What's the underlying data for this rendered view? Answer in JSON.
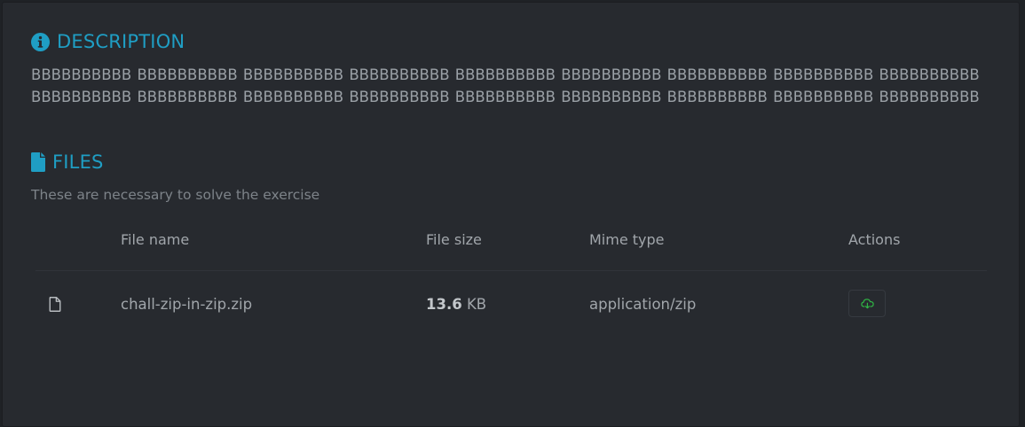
{
  "description": {
    "title": "DESCRIPTION",
    "text": "BBBBBBBBBB BBBBBBBBBB BBBBBBBBBB BBBBBBBBBB BBBBBBBBBB BBBBBBBBBB BBBBBBBBBB BBBBBBBBBB BBBBBBBBBB BBBBBBBBBB BBBBBBBBBB BBBBBBBBBB BBBBBBBBBB BBBBBBBBBB BBBBBBBBBB BBBBBBBBBB BBBBBBBBBB BBBBBBBBBB",
    "icon": "info-circle-icon"
  },
  "files": {
    "title": "FILES",
    "subtitle": "These are necessary to solve the exercise",
    "icon": "file-icon",
    "columns": {
      "name": "File name",
      "size": "File size",
      "mime": "Mime type",
      "actions": "Actions"
    },
    "rows": [
      {
        "name": "chall-zip-in-zip.zip",
        "size_value": "13.6",
        "size_unit": "KB",
        "mime": "application/zip",
        "action_icon": "cloud-download-icon"
      }
    ]
  },
  "colors": {
    "accent": "#1f9ec4",
    "panel_bg": "#272a2f",
    "download_icon": "#2fb344"
  }
}
